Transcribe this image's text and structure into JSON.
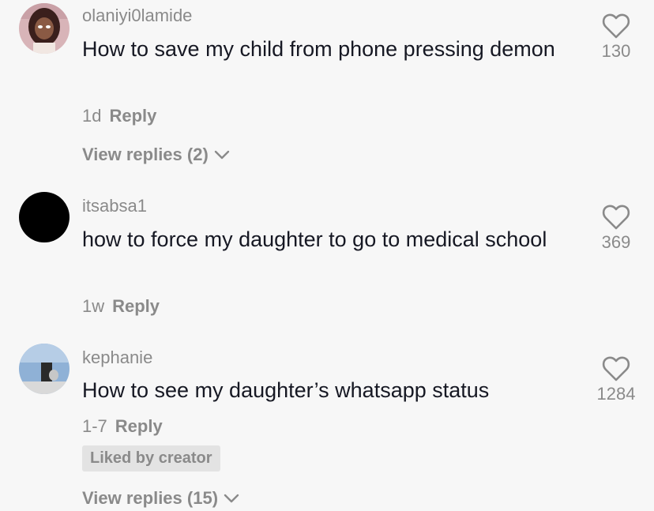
{
  "comments": [
    {
      "username": "olaniyi0lamide",
      "text": "How to save my child from phone pressing demon",
      "time": "1d",
      "reply_label": "Reply",
      "likes": "130",
      "view_replies": "View replies (2)"
    },
    {
      "username": "itsabsa1",
      "text": "how to force my daughter to go to medical school",
      "time": "1w",
      "reply_label": "Reply",
      "likes": "369"
    },
    {
      "username": "kephanie",
      "text": "How to see my daughter’s whatsapp status",
      "time": "1-7",
      "reply_label": "Reply",
      "likes": "1284",
      "badge": "Liked by creator",
      "view_replies": "View replies (15)"
    }
  ],
  "colors": {
    "background": "#f7f7f7",
    "text": "#161823",
    "muted": "#8a8a8a",
    "badge_bg": "#e3e3e3"
  },
  "icons": {
    "like": "heart-outline-icon",
    "expand": "chevron-down-icon"
  }
}
